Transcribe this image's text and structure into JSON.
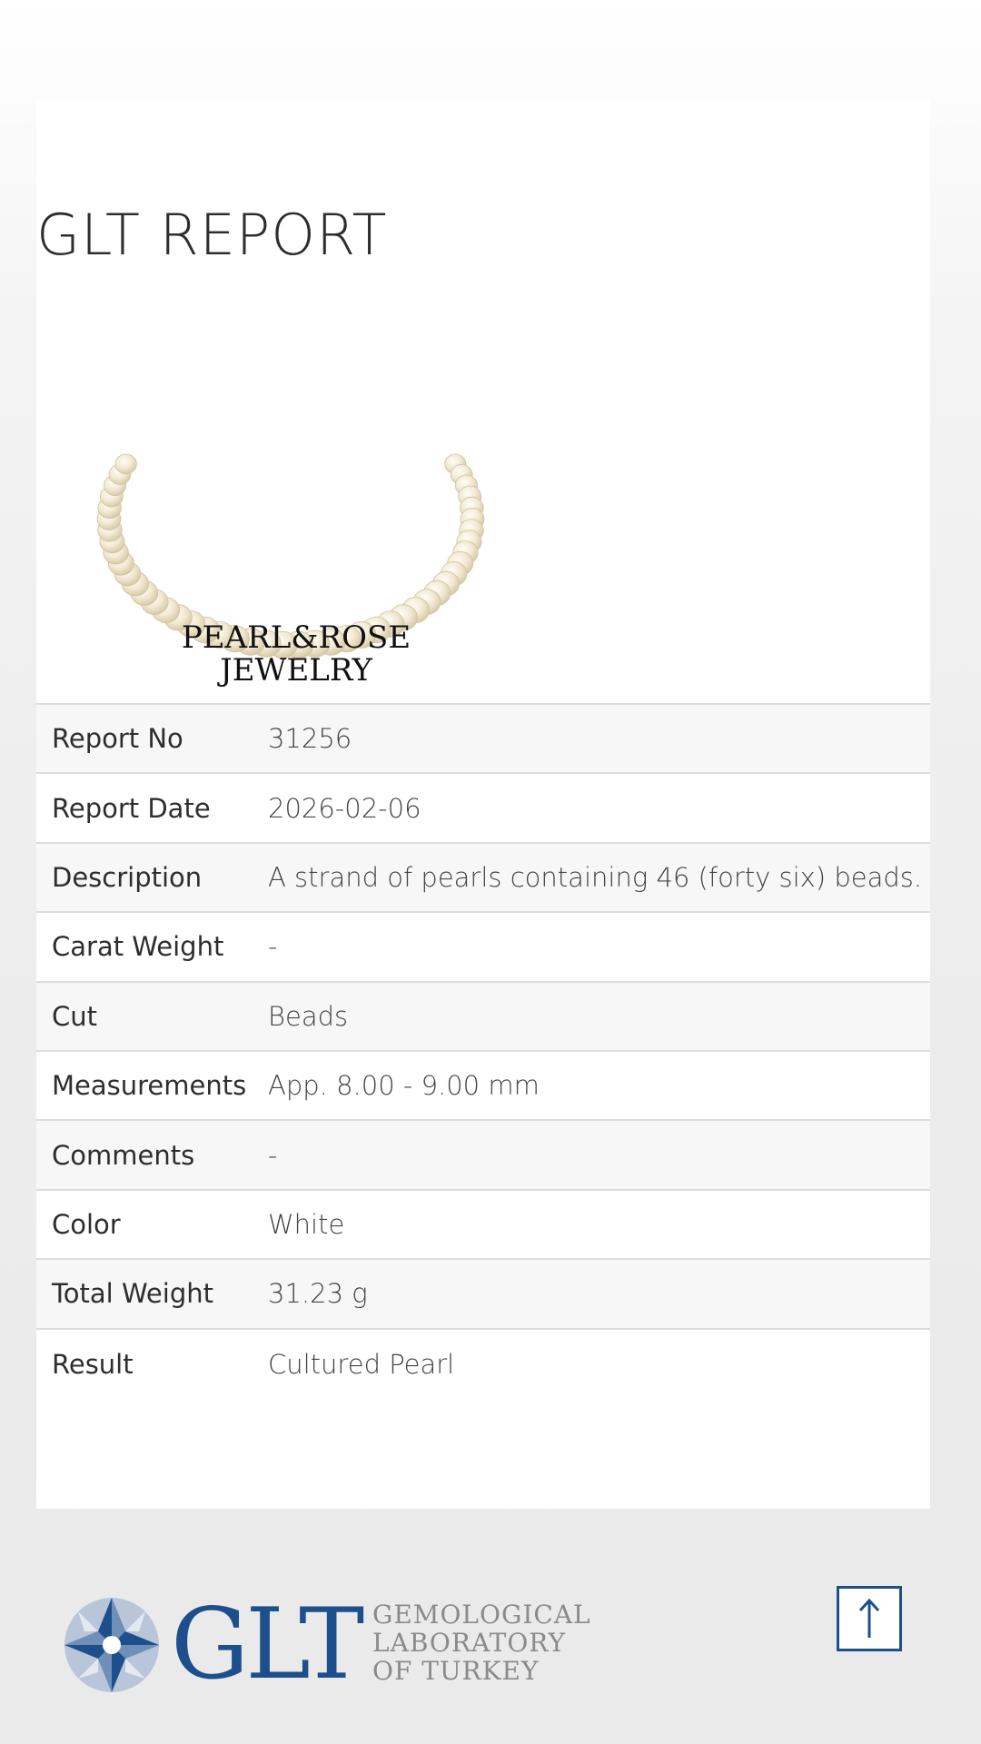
{
  "page": {
    "title": "GLT REPORT"
  },
  "brand": {
    "line1": "PEARL&ROSE",
    "line2": "JEWELRY"
  },
  "report": [
    {
      "label": "Report No",
      "value": "31256"
    },
    {
      "label": "Report Date",
      "value": "2026-02-06"
    },
    {
      "label": "Description",
      "value": "A strand of pearls containing 46 (forty six) beads."
    },
    {
      "label": "Carat Weight",
      "value": "-"
    },
    {
      "label": "Cut",
      "value": "Beads"
    },
    {
      "label": "Measurements",
      "value": "App. 8.00 - 9.00 mm"
    },
    {
      "label": "Comments",
      "value": "-"
    },
    {
      "label": "Color",
      "value": "White"
    },
    {
      "label": "Total Weight",
      "value": "31.23 g"
    },
    {
      "label": "Result",
      "value": "Cultured Pearl"
    }
  ],
  "footer": {
    "logo_letters": "GLT",
    "logo_line1": "GEMOLOGICAL",
    "logo_line2": "LABORATORY",
    "logo_line3": "OF TURKEY",
    "scroll_top_icon": "arrow-up-icon"
  },
  "colors": {
    "brand_blue": "#1d4f8c",
    "row_alt": "#f7f7f7",
    "divider": "#dcdcdc"
  }
}
